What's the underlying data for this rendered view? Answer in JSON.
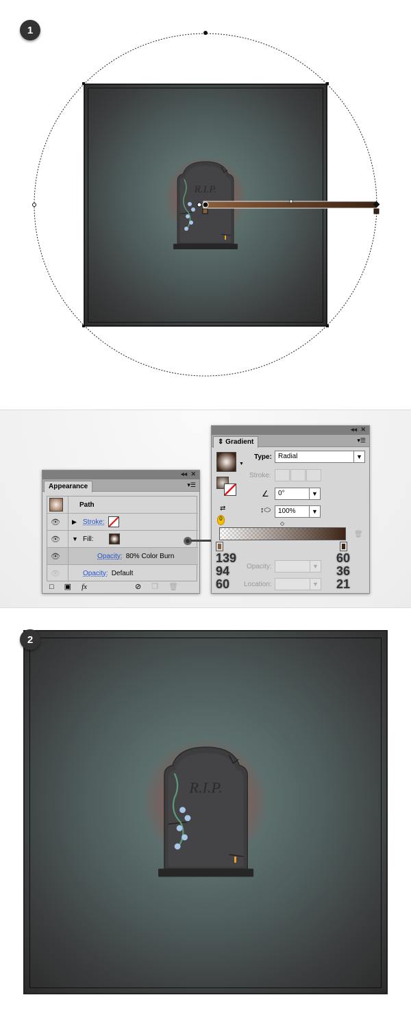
{
  "steps": {
    "one": "1",
    "two": "2"
  },
  "appearance": {
    "title": "Appearance",
    "object": "Path",
    "stroke_label": "Stroke:",
    "fill_label": "Fill:",
    "fill_opacity_label": "Opacity:",
    "fill_opacity_value": "80% Color Burn",
    "opacity_label": "Opacity:",
    "opacity_value": "Default",
    "fx_label": "fx"
  },
  "gradient": {
    "title": "Gradient",
    "type_label": "Type:",
    "type_value": "Radial",
    "stroke_label": "Stroke:",
    "angle_value": "0°",
    "aspect_value": "100%",
    "opacity_label": "Opacity:",
    "location_label": "Location:",
    "left_stop_rgb": [
      "139",
      "94",
      "60"
    ],
    "right_stop_rgb": [
      "60",
      "36",
      "21"
    ],
    "left_stop_color": "#8b5e3c",
    "right_stop_color": "#3c2415"
  },
  "tombstone_text": "R.I.P."
}
